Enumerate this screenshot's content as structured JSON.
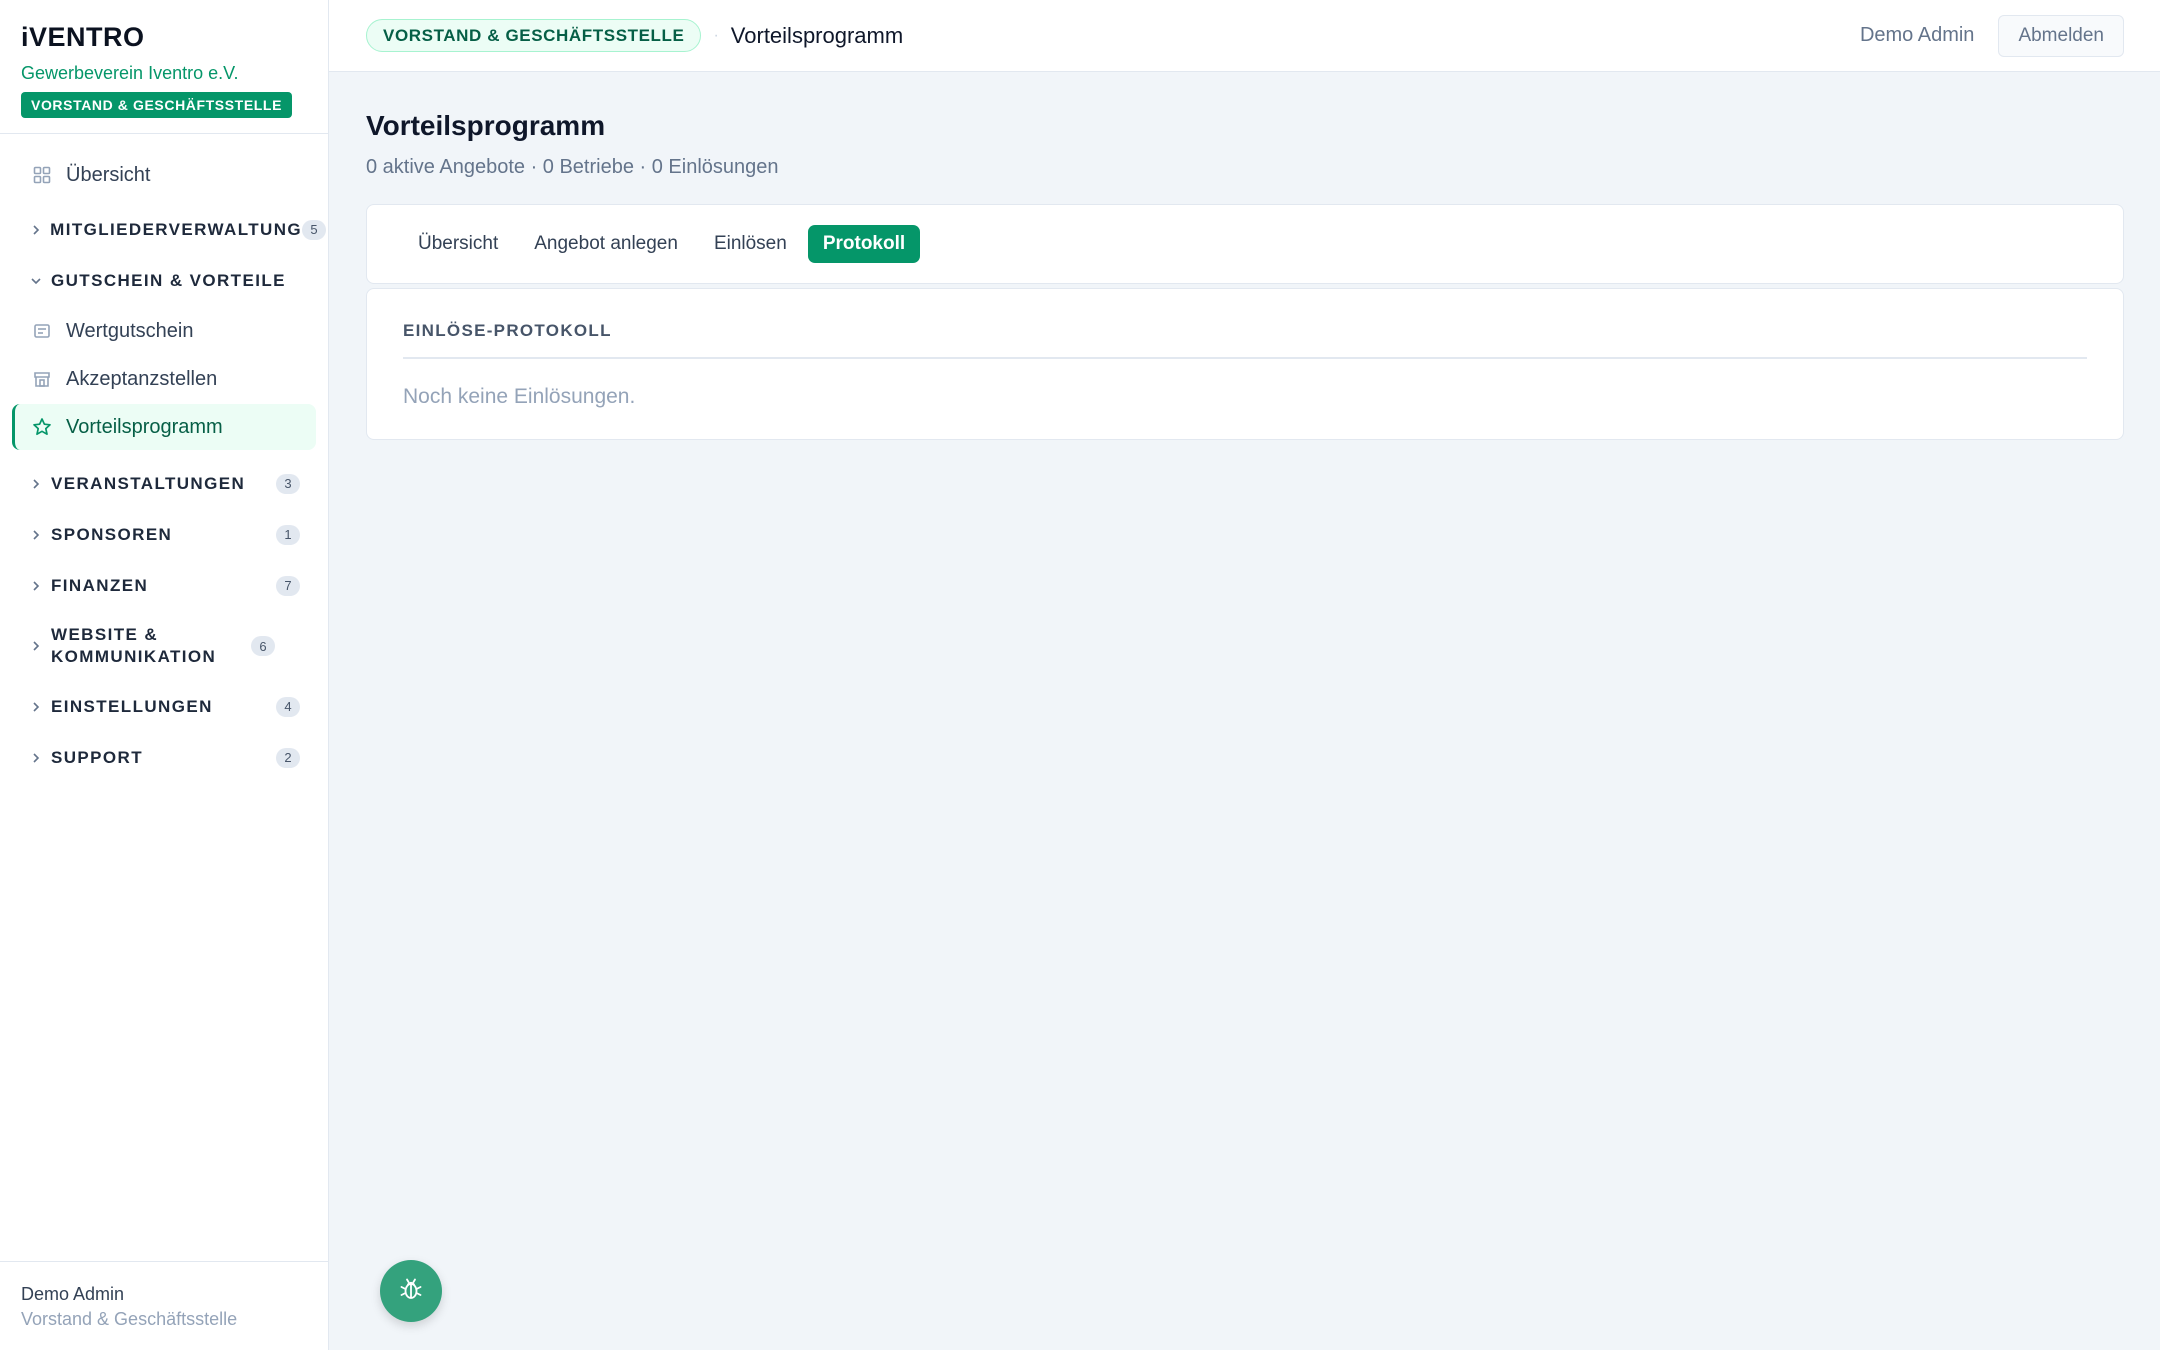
{
  "brand": {
    "logo": "iVENTRO",
    "org": "Gewerbeverein Iventro e.V.",
    "role_badge": "VORSTAND & GESCHÄFTSSTELLE"
  },
  "sidebar": {
    "overview": "Übersicht",
    "groups": [
      {
        "label": "MITGLIEDERVERWALTUNG",
        "count": "5"
      },
      {
        "label": "GUTSCHEIN & VORTEILE",
        "count": ""
      },
      {
        "label": "VERANSTALTUNGEN",
        "count": "3"
      },
      {
        "label": "SPONSOREN",
        "count": "1"
      },
      {
        "label": "FINANZEN",
        "count": "7"
      },
      {
        "label": "WEBSITE & KOMMUNIKATION",
        "count": "6"
      },
      {
        "label": "EINSTELLUNGEN",
        "count": "4"
      },
      {
        "label": "SUPPORT",
        "count": "2"
      }
    ],
    "sub_items": [
      {
        "label": "Wertgutschein",
        "icon": "voucher-icon"
      },
      {
        "label": "Akzeptanzstellen",
        "icon": "store-icon"
      },
      {
        "label": "Vorteilsprogramm",
        "icon": "star-icon"
      }
    ],
    "active_color": "#059669"
  },
  "footer": {
    "name": "Demo Admin",
    "role": "Vorstand & Geschäftsstelle"
  },
  "topbar": {
    "context_pill": "VORSTAND & GESCHÄFTSSTELLE",
    "separator": "·",
    "crumb": "Vorteilsprogramm",
    "user": "Demo Admin",
    "logout": "Abmelden"
  },
  "page": {
    "title": "Vorteilsprogramm",
    "subtitle": "0 aktive Angebote · 0 Betriebe · 0 Einlösungen"
  },
  "tabs": [
    {
      "label": "Übersicht"
    },
    {
      "label": "Angebot anlegen"
    },
    {
      "label": "Einlösen"
    },
    {
      "label": "Protokoll"
    }
  ],
  "active_tab": "Protokoll",
  "log": {
    "heading": "EINLÖSE-PROTOKOLL",
    "empty": "Noch keine Einlösungen."
  },
  "fab": {
    "icon": "bug-icon"
  }
}
